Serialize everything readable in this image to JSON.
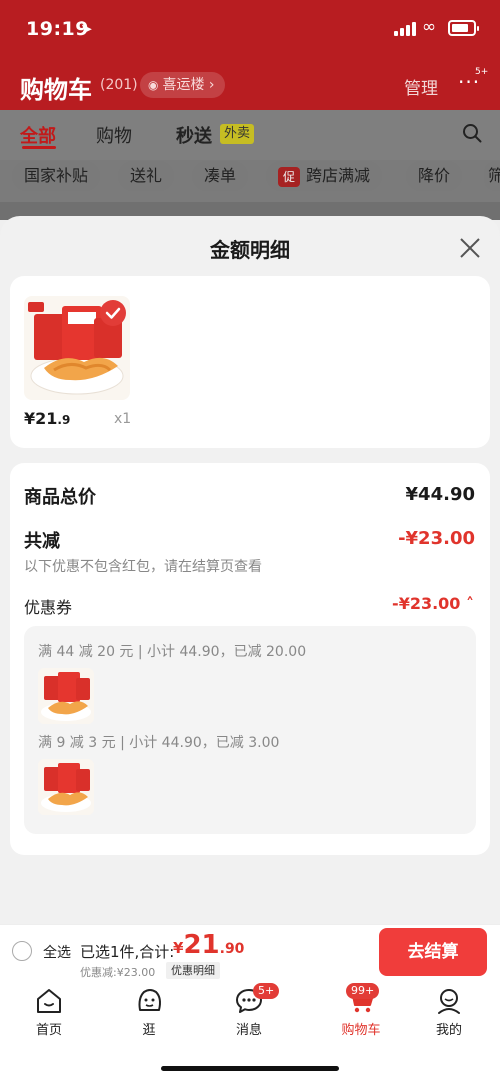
{
  "status": {
    "time": "19:19"
  },
  "header": {
    "title": "购物车",
    "count": "(201)",
    "address": "喜运楼",
    "manage": "管理",
    "more_badge": "5+"
  },
  "tabs": {
    "all": "全部",
    "shop": "购物",
    "seckill": "秒送",
    "takeout_tag": "外卖"
  },
  "filters": {
    "items": [
      "国家补贴",
      "送礼",
      "凑单",
      "跨店满减",
      "降价",
      "筛"
    ],
    "promo_icon": "促"
  },
  "modal": {
    "title": "金额明细",
    "product": {
      "price_int": "¥21",
      "price_frac": ".9",
      "qty": "x1"
    },
    "total_label": "商品总价",
    "total_value": "¥44.90",
    "reduce_label": "共减",
    "reduce_value": "-¥23.00",
    "note": "以下优惠不包含红包，请在结算页查看",
    "coupon_label": "优惠券",
    "coupon_value": "-¥23.00 ˄",
    "rules": [
      "满 44 减 20 元 | 小计 44.90，已减 20.00",
      "满 9 减 3 元 | 小计 44.90，已减 3.00"
    ]
  },
  "checkout": {
    "select_all": "全选",
    "selected_text": "已选1件,合计:",
    "total_cur": "¥",
    "total_int": "21",
    "total_frac": ".90",
    "discount_text": "优惠减:¥23.00",
    "detail_tag": "优惠明细",
    "pay_label": "去结算"
  },
  "tabbar": {
    "items": [
      {
        "label": "首页",
        "icon": "home-icon"
      },
      {
        "label": "逛",
        "icon": "browse-icon"
      },
      {
        "label": "消息",
        "icon": "message-icon",
        "badge": "5+"
      },
      {
        "label": "购物车",
        "icon": "cart-icon",
        "badge": "99+"
      },
      {
        "label": "我的",
        "icon": "profile-icon"
      }
    ]
  },
  "colors": {
    "accent": "#e0342c",
    "header_red": "#b81d21",
    "button_red": "#f03d3b"
  }
}
